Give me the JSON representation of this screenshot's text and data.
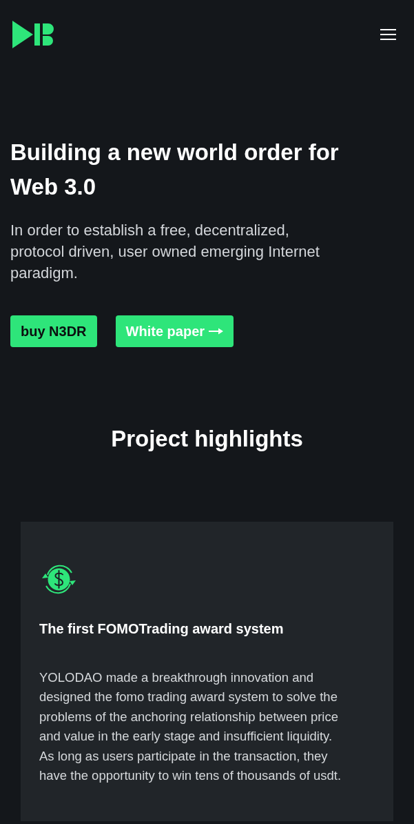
{
  "hero": {
    "title": "Building a new world order for Web 3.0",
    "subtitle": "In order to establish a free, decentralized, protocol driven, user owned emerging Internet paradigm.",
    "buttons": [
      {
        "label": "buy N3DR",
        "kind": "primary"
      },
      {
        "label": "White paper",
        "kind": "secondary"
      }
    ]
  },
  "highlights": {
    "title": "Project highlights",
    "cards": [
      {
        "title": "The first FOMOTrading award system",
        "text": "YOLODAO made a breakthrough innovation and designed the fomo trading award system to solve the problems of the anchoring relationship between price and value in the early stage and insufficient liquidity. As long as users participate in the transaction, they have the opportunity to win tens of thousands of usdt."
      }
    ]
  }
}
